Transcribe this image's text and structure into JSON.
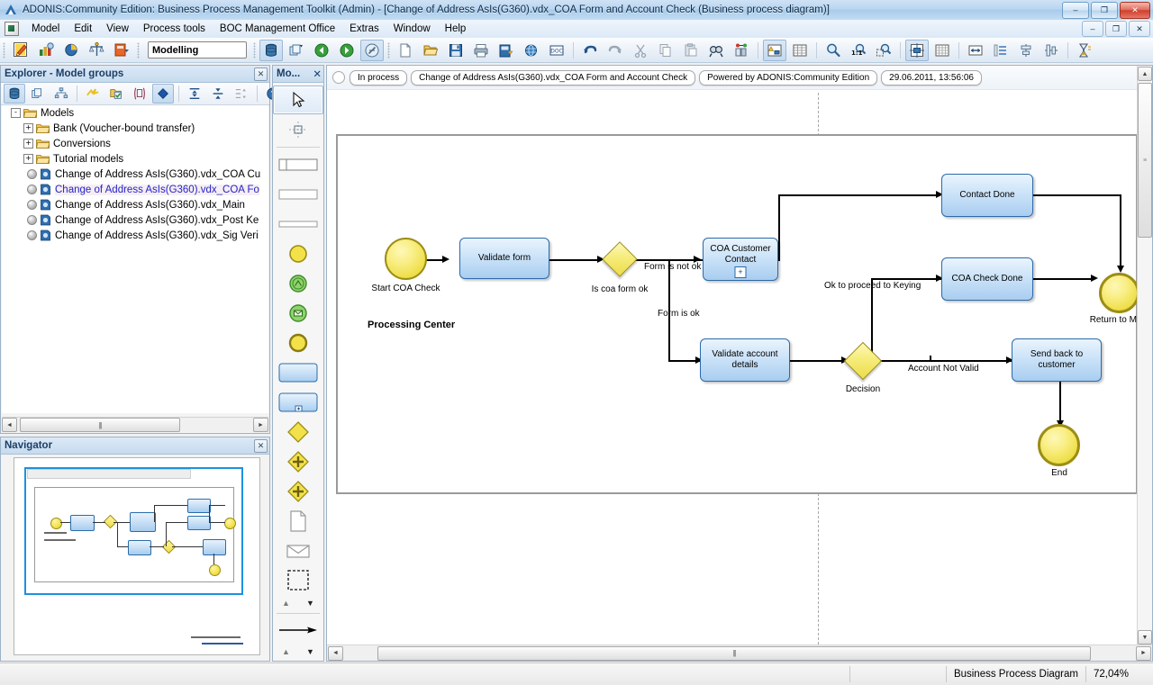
{
  "window": {
    "title": "ADONIS:Community Edition: Business Process Management Toolkit (Admin) - [Change of Address AsIs(G360).vdx_COA Form and Account Check (Business process diagram)]",
    "app_icon": "adonis-logo-icon",
    "minimize": "–",
    "restore": "❐",
    "close": "✕"
  },
  "menu": {
    "items": [
      {
        "label": "Model"
      },
      {
        "label": "Edit"
      },
      {
        "label": "View"
      },
      {
        "label": "Process tools"
      },
      {
        "label": "BOC Management Office"
      },
      {
        "label": "Extras"
      },
      {
        "label": "Window"
      },
      {
        "label": "Help"
      }
    ]
  },
  "toolbar": {
    "mode_combo_value": "Modelling",
    "groups": [
      {
        "icons": [
          "edit-model-icon",
          "analyse-icon",
          "simulate-icon",
          "evaluate-icon",
          "import-export-icon"
        ]
      },
      {
        "icons": [
          "database-icon",
          "model-groups-icon",
          "back-green-icon",
          "forward-green-icon",
          "navigate-off-icon"
        ]
      },
      {
        "icons": [
          "new-document-icon",
          "open-folder-icon",
          "save-icon",
          "print-icon",
          "export-icon",
          "publish-icon",
          "doc-generate-icon"
        ]
      },
      {
        "icons": [
          "undo-icon",
          "redo-icon",
          "cut-icon",
          "copy-icon",
          "paste-icon",
          "find-icon",
          "find-replace-icon"
        ]
      },
      {
        "icons": [
          "model-attributes-icon",
          "table-view-icon"
        ]
      },
      {
        "icons": [
          "zoom-icon",
          "zoom-100-icon",
          "zoom-fit-icon"
        ]
      },
      {
        "icons": [
          "center-icon",
          "grid-icon"
        ]
      },
      {
        "icons": [
          "align-width-icon",
          "align-distribute-icon",
          "align-center-v-icon",
          "align-center-h-icon"
        ]
      },
      {
        "icons": [
          "hourglass-icon"
        ]
      }
    ]
  },
  "explorer": {
    "title": "Explorer - Model groups",
    "close_label": "✕",
    "toolbar_icons": [
      "database-icon",
      "model-groups-icon",
      "hierarchy-icon",
      "lightning-icon",
      "import-check-icon",
      "copy-model-icon",
      "diamond-icon",
      "expand-all-icon",
      "collapse-all-icon",
      "expand-level-icon",
      "help-icon"
    ],
    "tree": [
      {
        "label": "Models",
        "level": 0,
        "toggle": "-",
        "icon": "folder-open-icon",
        "selected": false
      },
      {
        "label": "Bank (Voucher-bound transfer)",
        "level": 1,
        "toggle": "+",
        "icon": "folder-icon",
        "selected": false
      },
      {
        "label": "Conversions",
        "level": 1,
        "toggle": "+",
        "icon": "folder-icon",
        "selected": false
      },
      {
        "label": "Tutorial models",
        "level": 1,
        "toggle": "+",
        "icon": "folder-icon",
        "selected": false
      },
      {
        "label": "Change of Address AsIs(G360).vdx_COA Cu",
        "level": 2,
        "toggle": "",
        "icon": "model-icon",
        "selected": false
      },
      {
        "label": "Change of Address AsIs(G360).vdx_COA Fo",
        "level": 2,
        "toggle": "",
        "icon": "model-icon",
        "selected": true
      },
      {
        "label": "Change of Address AsIs(G360).vdx_Main",
        "level": 2,
        "toggle": "",
        "icon": "model-icon",
        "selected": false
      },
      {
        "label": "Change of Address AsIs(G360).vdx_Post Ke",
        "level": 2,
        "toggle": "",
        "icon": "model-icon",
        "selected": false
      },
      {
        "label": "Change of Address AsIs(G360).vdx_Sig Veri",
        "level": 2,
        "toggle": "",
        "icon": "model-icon",
        "selected": false
      }
    ],
    "scroll_left": "◄",
    "scroll_right": "►",
    "scroll_grip": "|||"
  },
  "navigator": {
    "title": "Navigator",
    "close_label": "✕"
  },
  "palette": {
    "title": "Mo...",
    "close_label": "✕",
    "items": [
      {
        "name": "select-pointer-tool",
        "pressed": true
      },
      {
        "name": "connector-tool",
        "pressed": false
      },
      {
        "name": "swimlane-pool-tool",
        "pressed": false
      },
      {
        "name": "lane-tool",
        "pressed": false
      },
      {
        "name": "separator-bar-tool",
        "pressed": false
      },
      {
        "name": "start-event-tool",
        "pressed": false
      },
      {
        "name": "intermediate-event-tool",
        "pressed": false
      },
      {
        "name": "message-event-tool",
        "pressed": false
      },
      {
        "name": "end-event-tool",
        "pressed": false
      },
      {
        "name": "task-tool",
        "pressed": false
      },
      {
        "name": "subprocess-tool",
        "pressed": false
      },
      {
        "name": "gateway-tool",
        "pressed": false
      },
      {
        "name": "parallel-gateway-tool",
        "pressed": false
      },
      {
        "name": "inclusive-gateway-tool",
        "pressed": false
      },
      {
        "name": "document-tool",
        "pressed": false
      },
      {
        "name": "message-tool",
        "pressed": false
      },
      {
        "name": "group-tool",
        "pressed": false
      }
    ],
    "scroll_up": "▲",
    "scroll_down": "▼",
    "sequence_flow_tool": "sequence-flow-tool"
  },
  "document": {
    "minimize": "–",
    "restore": "❐",
    "close": "✕",
    "breadcrumbs": [
      {
        "label": "In process"
      },
      {
        "label": "Change of Address AsIs(G360).vdx_COA Form and Account Check"
      },
      {
        "label": "Powered by ADONIS:Community Edition"
      },
      {
        "label": "29.06.2011, 13:56:06"
      }
    ]
  },
  "diagram": {
    "pool_label": "Processing Center",
    "nodes": [
      {
        "id": "start",
        "type": "start-event",
        "label": "Start COA Check"
      },
      {
        "id": "validateform",
        "type": "task",
        "label": "Validate form"
      },
      {
        "id": "iscoaok",
        "type": "gateway",
        "label": "Is coa form ok"
      },
      {
        "id": "coacontact",
        "type": "subprocess",
        "label": "COA Customer Contact",
        "marker": "+"
      },
      {
        "id": "contactdone",
        "type": "task",
        "label": "Contact Done"
      },
      {
        "id": "coacheckdone",
        "type": "task",
        "label": "COA Check Done"
      },
      {
        "id": "returnmain",
        "type": "end-event",
        "label": "Return to Main"
      },
      {
        "id": "validateacct",
        "type": "task",
        "label": "Validate account details"
      },
      {
        "id": "decision",
        "type": "gateway",
        "label": "Decision"
      },
      {
        "id": "sendback",
        "type": "task",
        "label": "Send back to customer"
      },
      {
        "id": "end",
        "type": "end-event",
        "label": "End"
      }
    ],
    "edge_labels": [
      {
        "id": "formnotok",
        "label": "Form is not ok"
      },
      {
        "id": "formok",
        "label": "Form is ok"
      },
      {
        "id": "oktokeying",
        "label": "Ok to proceed to Keying"
      },
      {
        "id": "acctnotvalid",
        "label": "Account Not Valid"
      }
    ]
  },
  "statusbar": {
    "type_label": "Business Process Diagram",
    "zoom_label": "72,04%"
  },
  "colors": {
    "titlebar_accent": "#b9d6f0",
    "event_fill": "#f3e14a",
    "task_fill": "#a9cdf0",
    "task_border": "#2c6aa8",
    "selected_tree_text": "#2424c8",
    "close_button": "#cf3f2b"
  }
}
